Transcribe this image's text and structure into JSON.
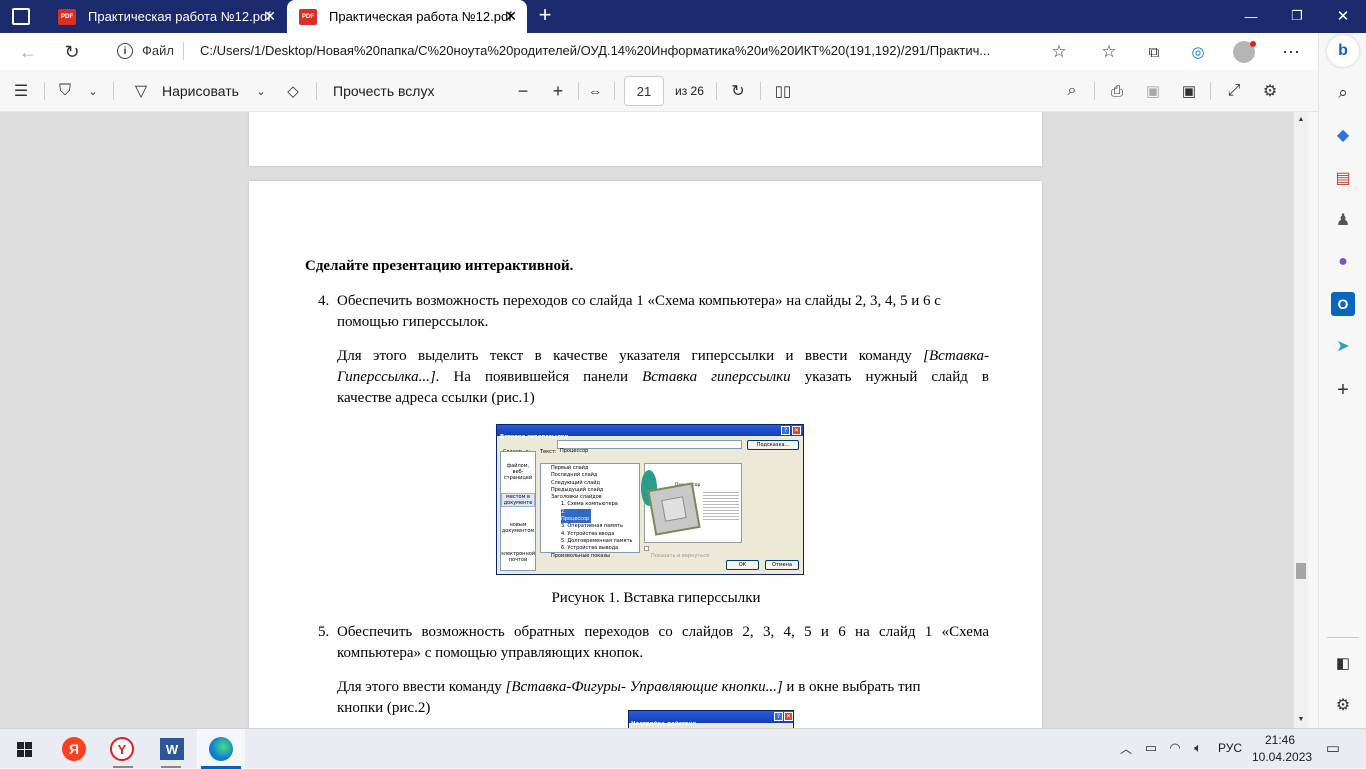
{
  "tabs": [
    {
      "title": "Практическая работа №12.pdf",
      "active": false
    },
    {
      "title": "Практическая работа №12.pdf",
      "active": true
    }
  ],
  "address": {
    "scheme": "Файл",
    "url": "C:/Users/1/Desktop/Новая%20папка/C%20ноута%20родителей/ОУД.14%20Информатика%20и%20ИКТ%20(191,192)/291/Практич..."
  },
  "toolbar": {
    "draw_label": "Нарисовать",
    "read_aloud_label": "Прочесть вслух",
    "page_current": "21",
    "page_total": "из 26"
  },
  "doc": {
    "heading": "Сделайте презентацию интерактивной.",
    "item4_num": "4.",
    "item4_line1": "Обеспечить возможность переходов со слайда 1 «Схема компьютера» на слайды 2, 3, 4, 5 и 6 с",
    "item4_line2": "помощью гиперссылок.",
    "para1_a": "Для этого выделить текст в качестве указателя гиперссылки и ввести команду ",
    "para1_b": "[Вставка-",
    "para1_c": "Гиперссылка...]",
    "para1_d": ". На появившейся панели ",
    "para1_e": "Вставка гиперссылки",
    "para1_f": " указать нужный слайд в",
    "para1_g": "качестве адреса ссылки (рис.1)",
    "caption1": "Рисунок 1. Вставка гиперссылки",
    "item5_num": "5.",
    "item5_line1": "Обеспечить возможность обратных переходов со слайдов 2, 3, 4, 5 и 6 на слайд 1 «Схема",
    "item5_line2": "компьютера» с помощью управляющих кнопок.",
    "para2_a": "Для этого ввести команду ",
    "para2_b": "[Вставка-Фигуры- Управляющие кнопки...]",
    "para2_c": " и в окне выбрать тип",
    "para2_d": "кнопки (рис.2)"
  },
  "dialog1": {
    "title": "Вставка гиперссылки",
    "link_to": "Связать с:",
    "text_label": "Текст:",
    "text_value": "Процессор",
    "hint_btn": "Подсказка...",
    "places": [
      "файлом, веб-страницей",
      "местом в документе",
      "новым документом",
      "электронной почтой"
    ],
    "choose_place": "Выберите место в документе:",
    "tree": [
      "Первый слайд",
      "Последний слайд",
      "Следующий слайд",
      "Предыдущий слайд",
      "Заголовки слайдов",
      "1. Схема компьютера",
      "2. Процессор",
      "3. Оперативная память",
      "4. Устройства ввода",
      "5. Долговременная память",
      "6. Устройства вывода",
      "Произвольные показы"
    ],
    "preview_label": "Просмотр слайда:",
    "slide_title": "Процессор",
    "show_return": "Показать и вернуться",
    "ok": "ОК",
    "cancel": "Отмена"
  },
  "dialog2": {
    "title": "Настройка действия"
  },
  "taskbar": {
    "lang": "РУС",
    "time": "21:46",
    "date": "10.04.2023"
  }
}
